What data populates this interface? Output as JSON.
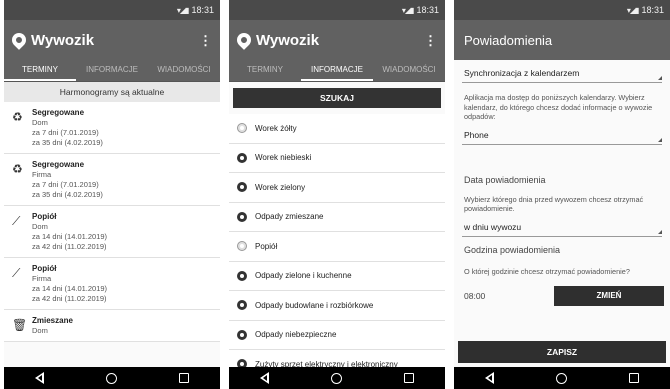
{
  "statusbar": {
    "time": "18:31"
  },
  "app": {
    "title": "Wywozik",
    "menu_glyph": "⋮"
  },
  "tabs": [
    "TERMINY",
    "INFORMACJE",
    "WIADOMOŚCI"
  ],
  "schedule": {
    "notice": "Harmonogramy są aktualne",
    "items": [
      {
        "name": "Segregowane",
        "place": "Dom",
        "next": "za 7 dni (7.01.2019)",
        "after": "za 35 dni (4.02.2019)",
        "icon": "recycle-icon",
        "glyph": "♻"
      },
      {
        "name": "Segregowane",
        "place": "Firma",
        "next": "za 7 dni (7.01.2019)",
        "after": "za 35 dni (4.02.2019)",
        "icon": "recycle-icon",
        "glyph": "♻"
      },
      {
        "name": "Popiół",
        "place": "Dom",
        "next": "za 14 dni (14.01.2019)",
        "after": "za 42 dni (11.02.2019)",
        "icon": "broom-icon",
        "glyph": "⟋"
      },
      {
        "name": "Popiół",
        "place": "Firma",
        "next": "za 14 dni (14.01.2019)",
        "after": "za 42 dni (11.02.2019)",
        "icon": "broom-icon",
        "glyph": "⟋"
      },
      {
        "name": "Zmieszane",
        "place": "Dom",
        "next": "",
        "after": "",
        "icon": "trash-icon",
        "glyph": "🗑"
      }
    ]
  },
  "info": {
    "search_label": "SZUKAJ",
    "items": [
      {
        "label": "Worek żółty",
        "light": true
      },
      {
        "label": "Worek niebieski",
        "light": false
      },
      {
        "label": "Worek zielony",
        "light": false
      },
      {
        "label": "Odpady zmieszane",
        "light": false
      },
      {
        "label": "Popiół",
        "light": true
      },
      {
        "label": "Odpady zielone i kuchenne",
        "light": false
      },
      {
        "label": "Odpady budowlane i rozbiórkowe",
        "light": false
      },
      {
        "label": "Odpady niebezpieczne",
        "light": false
      },
      {
        "label": "Zużyty sprzęt elektryczny i elektroniczny",
        "light": false
      }
    ]
  },
  "settings": {
    "title": "Powiadomienia",
    "calendar_sync": "Synchronizacja z kalendarzem",
    "calendar_desc": "Aplikacja ma dostęp do poniższych kalendarzy. Wybierz kalendarz, do którego chcesz dodać informacje o wywozie odpadów:",
    "calendar_value": "Phone",
    "date_head": "Data powiadomienia",
    "date_desc": "Wybierz którego dnia przed wywozem chcesz otrzymać powiadomienie.",
    "date_value": "w dniu wywozu",
    "hour_head": "Godzina powiadomienia",
    "hour_desc": "O której godzinie chcesz otrzymać powiadomienie?",
    "time_value": "08:00",
    "change_label": "ZMIEŃ",
    "save_label": "ZAPISZ"
  },
  "colors": {
    "appbar": "#616161",
    "button": "#2f2f2f",
    "navbar": "#000000"
  }
}
